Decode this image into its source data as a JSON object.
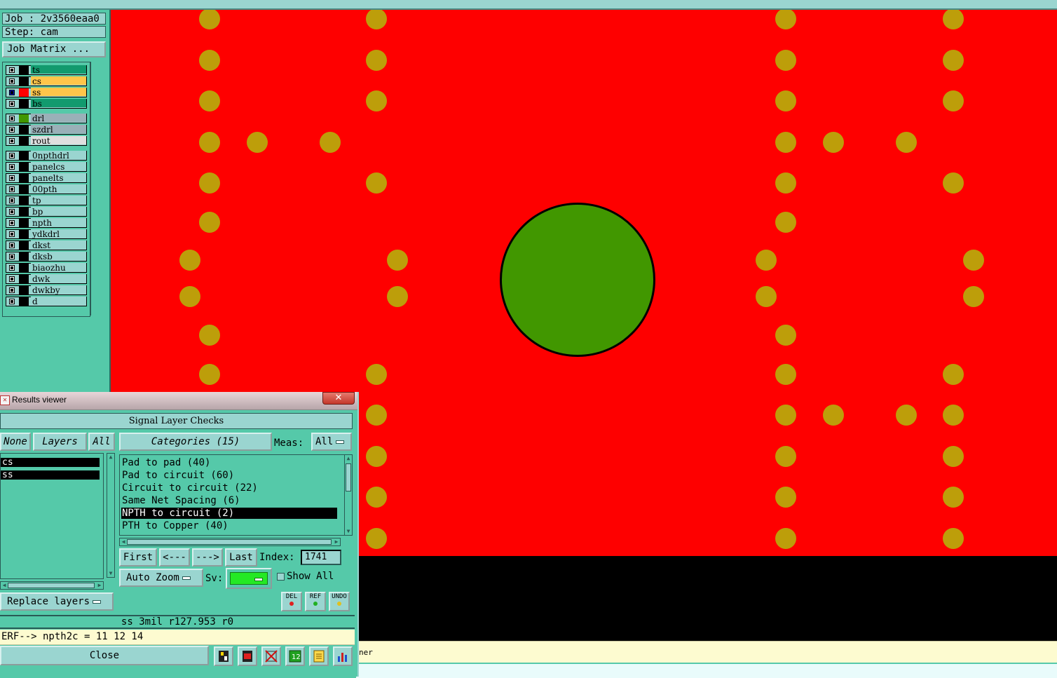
{
  "job": {
    "job_label": "Job : 2v3560eaa0",
    "step_label": "Step: cam",
    "matrix_button": "Job Matrix ..."
  },
  "layers": [
    {
      "name": "ts",
      "swatch": "#000000",
      "row_color": "#129a6e"
    },
    {
      "name": "cs",
      "swatch": "#000000",
      "row_color": "#ffc54a"
    },
    {
      "name": "ss",
      "swatch": "#ff0000",
      "row_color": "#ffc54a",
      "active": true
    },
    {
      "name": "bs",
      "swatch": "#000000",
      "row_color": "#129a6e"
    },
    {
      "name": "drl",
      "swatch": "#419700",
      "row_color": "#9ab0b8"
    },
    {
      "name": "szdrl",
      "swatch": "#000000",
      "row_color": "#9ab0b8"
    },
    {
      "name": "rout",
      "swatch": "#000000",
      "row_color": "#dfdfdf"
    },
    {
      "name": "0npthdrl",
      "swatch": "#000000",
      "row_color": "#9ad5d0"
    },
    {
      "name": "panelcs",
      "swatch": "#000000",
      "row_color": "#9ad5d0"
    },
    {
      "name": "panelts",
      "swatch": "#000000",
      "row_color": "#9ad5d0"
    },
    {
      "name": "00pth",
      "swatch": "#000000",
      "row_color": "#9ad5d0"
    },
    {
      "name": "tp",
      "swatch": "#000000",
      "row_color": "#9ad5d0"
    },
    {
      "name": "bp",
      "swatch": "#000000",
      "row_color": "#9ad5d0"
    },
    {
      "name": "npth",
      "swatch": "#000000",
      "row_color": "#9ad5d0"
    },
    {
      "name": "ydkdrl",
      "swatch": "#000000",
      "row_color": "#9ad5d0"
    },
    {
      "name": "dkst",
      "swatch": "#000000",
      "row_color": "#9ad5d0"
    },
    {
      "name": "dksb",
      "swatch": "#000000",
      "row_color": "#9ad5d0"
    },
    {
      "name": "biaozhu",
      "swatch": "#000000",
      "row_color": "#9ad5d0"
    },
    {
      "name": "dwk",
      "swatch": "#000000",
      "row_color": "#9ad5d0"
    },
    {
      "name": "dwkby",
      "swatch": "#000000",
      "row_color": "#9ad5d0"
    },
    {
      "name": "d",
      "swatch": "#000000",
      "row_color": "#9ad5d0"
    }
  ],
  "colors": {
    "background": "#fe0000",
    "pad": "#bd9e0a",
    "npth_hole": "#419700",
    "panel": "#55c9a9",
    "panel_light": "#9ad5d0"
  },
  "statusbar": {
    "text": "ner"
  },
  "results_viewer": {
    "title": "Results viewer",
    "close_x": "✕",
    "section_title": "Signal Layer Checks",
    "none_btn": "None",
    "layers_btn": "Layers",
    "all_btn": "All",
    "categories_btn": "Categories (15)",
    "meas_label": "Meas:",
    "meas_value": "All",
    "selected_layers": [
      "cs",
      "ss"
    ],
    "categories": [
      "Pad to pad (40)",
      "Pad to circuit (60)",
      "Circuit to circuit (22)",
      "Same Net Spacing (6)",
      "NPTH to circuit (2)",
      "PTH to Copper (40)"
    ],
    "selected_category_index": 4,
    "nav": {
      "first": "First",
      "prev": "<---",
      "next": "--->",
      "last": "Last",
      "index_label": "Index:",
      "index_value": "1741"
    },
    "auto_zoom": "Auto Zoom",
    "sv_label": "Sv:",
    "show_all": "Show All",
    "replace_layers": "Replace layers",
    "small_buttons": [
      {
        "label": "DEL",
        "dot": "#e02020"
      },
      {
        "label": "REF",
        "dot": "#20b020"
      },
      {
        "label": "UNDO",
        "dot": "#e0c020"
      }
    ],
    "info_line": "ss 3mil   r127.953  r0",
    "erf_line": "ERF--> npth2c = 11 12 14",
    "close_btn": "Close"
  }
}
